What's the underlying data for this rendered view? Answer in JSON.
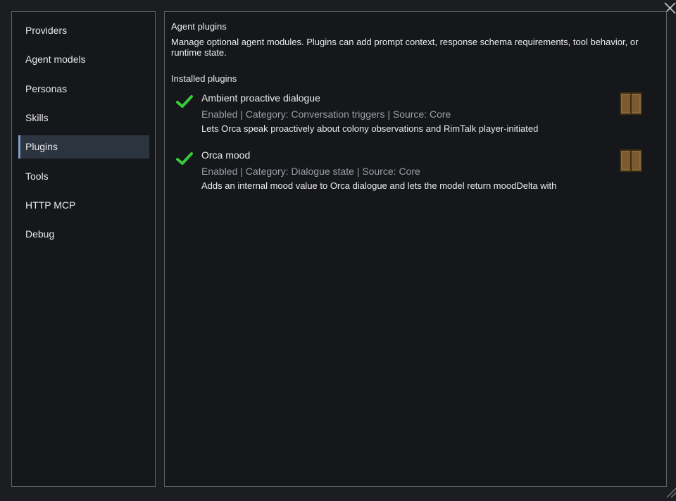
{
  "sidebar": {
    "items": [
      {
        "label": "Providers",
        "active": false
      },
      {
        "label": "Agent models",
        "active": false
      },
      {
        "label": "Personas",
        "active": false
      },
      {
        "label": "Skills",
        "active": false
      },
      {
        "label": "Plugins",
        "active": true
      },
      {
        "label": "Tools",
        "active": false
      },
      {
        "label": "HTTP MCP",
        "active": false
      },
      {
        "label": "Debug",
        "active": false
      }
    ]
  },
  "main": {
    "title": "Agent plugins",
    "description": "Manage optional agent modules. Plugins can add prompt context, response schema requirements, tool behavior, or runtime state.",
    "installed_heading": "Installed plugins",
    "plugins": [
      {
        "name": "Ambient proactive dialogue",
        "meta": "Enabled | Category: Conversation triggers | Source: Core",
        "text": "Lets Orca speak proactively about colony observations and RimTalk player-initiated",
        "status_icon": "check-icon",
        "action_icon": "book-icon"
      },
      {
        "name": "Orca mood",
        "meta": "Enabled | Category: Dialogue state | Source: Core",
        "text": "Adds an internal mood value to Orca dialogue and lets the model return moodDelta with",
        "status_icon": "check-icon",
        "action_icon": "book-icon"
      }
    ]
  },
  "colors": {
    "accent": "#7d9fc7",
    "check": "#39c93a",
    "muted_text": "#9aa0a6",
    "book": "#8a6a3a"
  }
}
